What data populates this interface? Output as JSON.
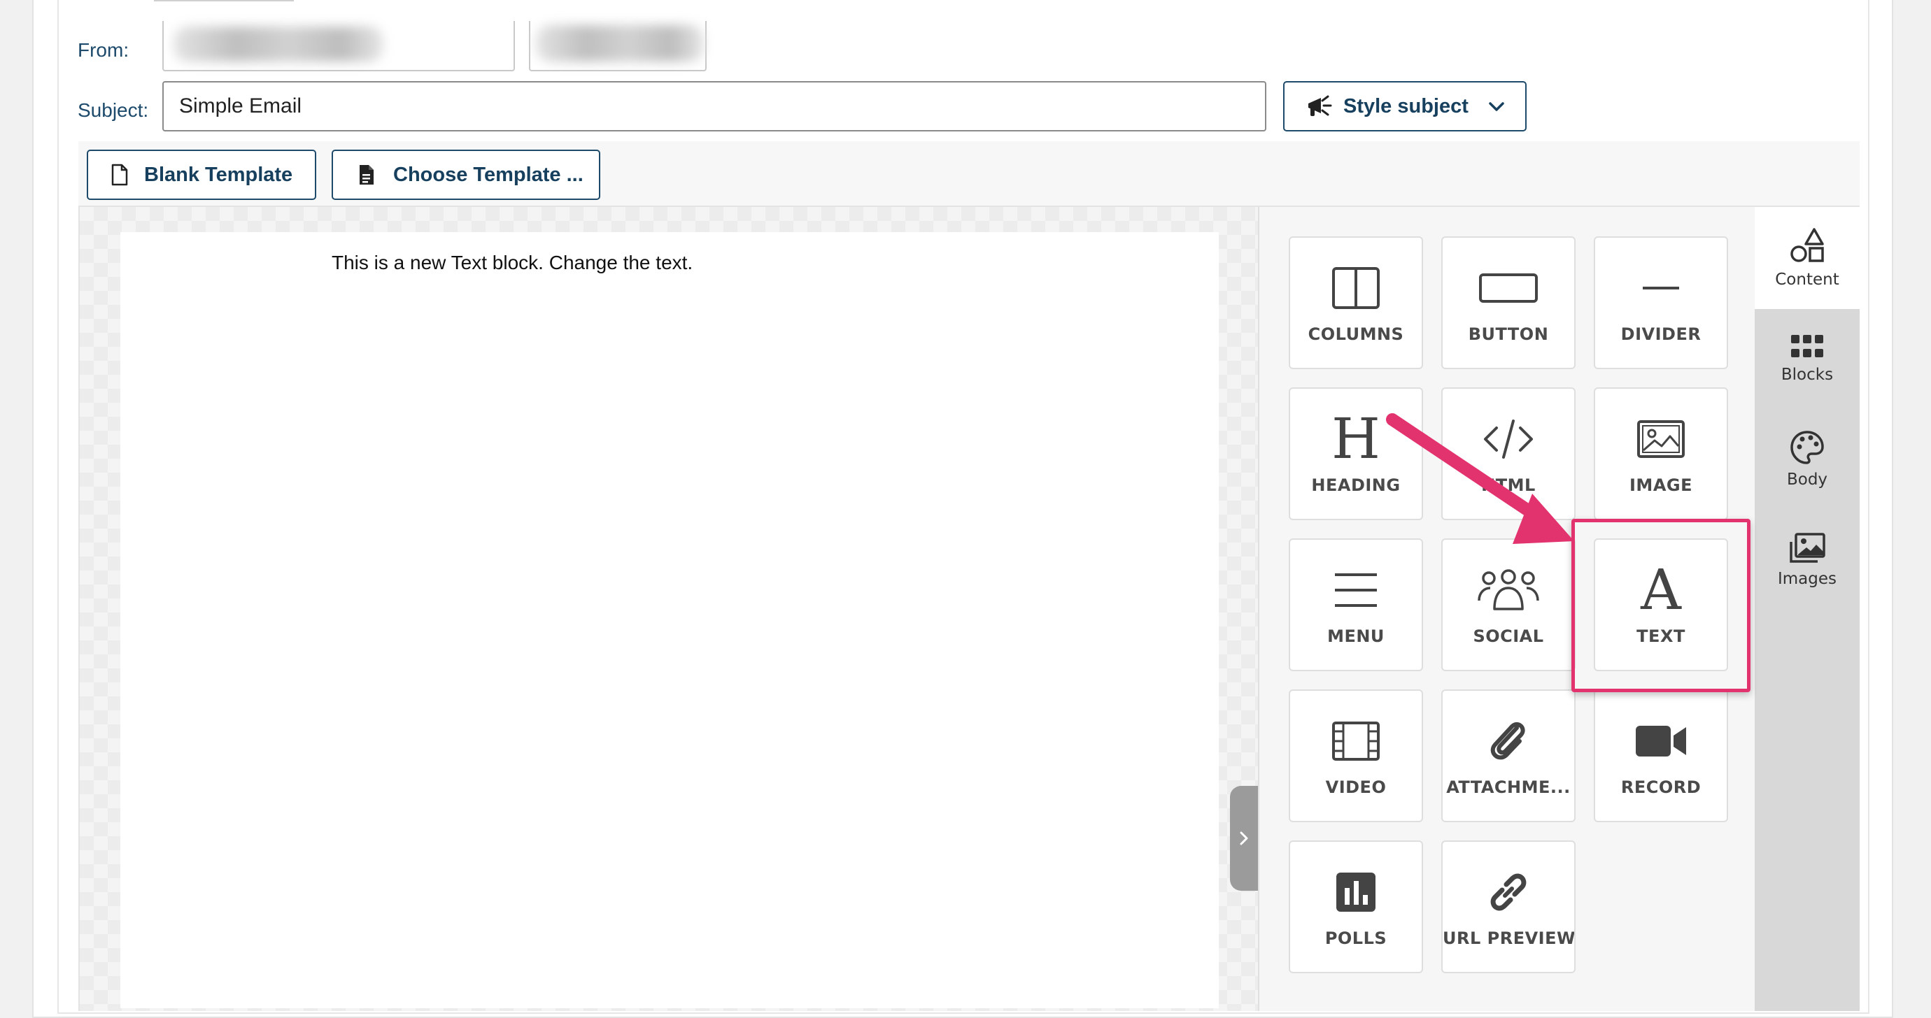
{
  "form": {
    "from_label": "From:",
    "subject_label": "Subject:",
    "subject_value": "Simple Email",
    "style_subject_button": "Style subject"
  },
  "toolbar": {
    "blank_template": "Blank Template",
    "choose_template": "Choose Template ..."
  },
  "editor": {
    "text_block": "This is a new Text block. Change the text."
  },
  "content_tiles": [
    {
      "label": "COLUMNS",
      "icon": "columns-icon"
    },
    {
      "label": "BUTTON",
      "icon": "button-icon"
    },
    {
      "label": "DIVIDER",
      "icon": "divider-icon"
    },
    {
      "label": "HEADING",
      "icon": "heading-icon",
      "glyph": "H"
    },
    {
      "label": "HTML",
      "icon": "html-icon"
    },
    {
      "label": "IMAGE",
      "icon": "image-icon"
    },
    {
      "label": "MENU",
      "icon": "menu-icon"
    },
    {
      "label": "SOCIAL",
      "icon": "social-icon"
    },
    {
      "label": "TEXT",
      "icon": "text-icon",
      "glyph": "A"
    },
    {
      "label": "VIDEO",
      "icon": "video-icon"
    },
    {
      "label": "ATTACHME...",
      "icon": "paperclip-icon"
    },
    {
      "label": "RECORD",
      "icon": "camera-icon"
    },
    {
      "label": "POLLS",
      "icon": "polls-icon"
    },
    {
      "label": "URL PREVIEW",
      "icon": "link-icon"
    }
  ],
  "side_tabs": [
    {
      "label": "Content",
      "icon": "shapes-icon",
      "active": true
    },
    {
      "label": "Blocks",
      "icon": "grid-icon",
      "active": false
    },
    {
      "label": "Body",
      "icon": "palette-icon",
      "active": false
    },
    {
      "label": "Images",
      "icon": "images-icon",
      "active": false
    }
  ],
  "colors": {
    "brand": "#1d4a6b",
    "highlight": "#e3336e"
  }
}
